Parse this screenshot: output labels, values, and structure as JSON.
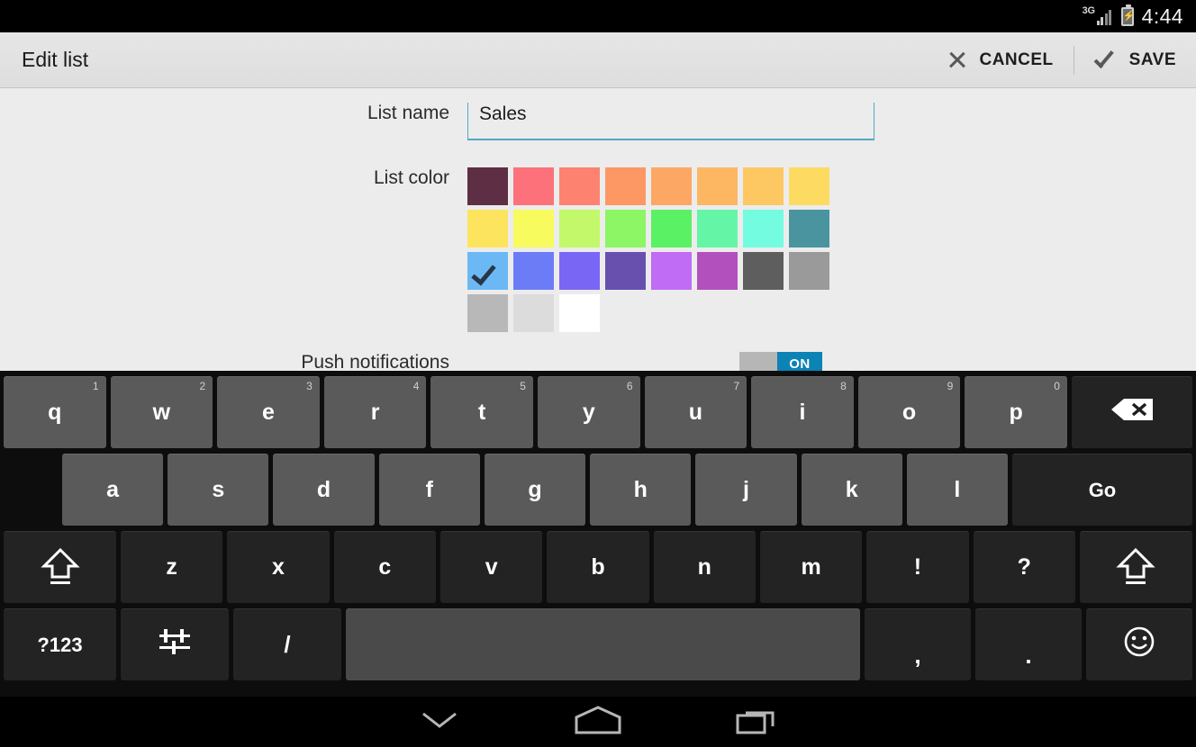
{
  "statusbar": {
    "network": "3G",
    "time": "4:44"
  },
  "actionbar": {
    "title": "Edit list",
    "cancel_label": "CANCEL",
    "save_label": "SAVE"
  },
  "form": {
    "name_label": "List name",
    "name_value": "Sales",
    "name_placeholder": "List name",
    "color_label": "List color",
    "push_label": "Push notifications",
    "push_state": "ON",
    "accent_underline": "#53a8c4",
    "toggle_on_color": "#0d82b5",
    "selected_index": 16,
    "swatches": [
      "#5e2e44",
      "#fd717a",
      "#fd8270",
      "#fd9763",
      "#fca764",
      "#fdb763",
      "#fdc762",
      "#fddb62",
      "#fde45e",
      "#f8fb5e",
      "#c2f86a",
      "#8df665",
      "#5bf164",
      "#64f6a6",
      "#73fcdf",
      "#4a949f",
      "#6bb8f5",
      "#6b7cf6",
      "#7a66f4",
      "#6850ae",
      "#c06cf4",
      "#b251bd",
      "#5e5e5e",
      "#9a9a9a",
      "#b8b8b8",
      "#dcdcdc",
      "#ffffff"
    ]
  },
  "keyboard": {
    "row1": [
      {
        "label": "q",
        "sup": "1"
      },
      {
        "label": "w",
        "sup": "2"
      },
      {
        "label": "e",
        "sup": "3"
      },
      {
        "label": "r",
        "sup": "4"
      },
      {
        "label": "t",
        "sup": "5"
      },
      {
        "label": "y",
        "sup": "6"
      },
      {
        "label": "u",
        "sup": "7"
      },
      {
        "label": "i",
        "sup": "8"
      },
      {
        "label": "o",
        "sup": "9"
      },
      {
        "label": "p",
        "sup": "0"
      }
    ],
    "row2": [
      "a",
      "s",
      "d",
      "f",
      "g",
      "h",
      "j",
      "k",
      "l"
    ],
    "row2_action": "Go",
    "row3": [
      "z",
      "x",
      "c",
      "v",
      "b",
      "n",
      "m",
      "!",
      "?"
    ],
    "row4": {
      "symbols": "?123",
      "slash": "/",
      "comma": ",",
      "period": "."
    },
    "backspace_icon": "backspace-icon",
    "shift_icon": "shift-icon",
    "settings_icon": "keyboard-settings-icon",
    "emoji_icon": "emoji-icon",
    "space_label": ""
  },
  "navbar": {
    "back_icon": "hide-keyboard-chevron-icon",
    "home_icon": "home-icon",
    "recents_icon": "recent-apps-icon"
  }
}
